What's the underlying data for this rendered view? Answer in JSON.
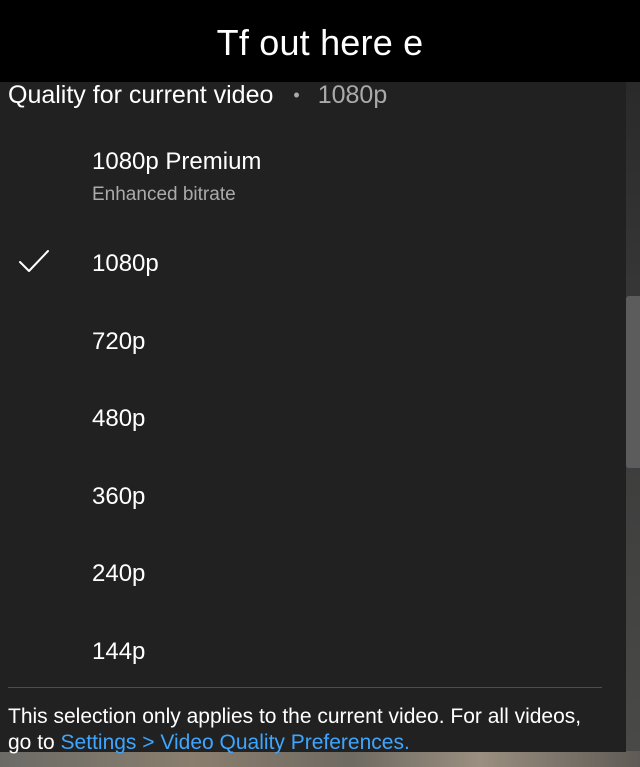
{
  "meme": {
    "title": "Tf out here e"
  },
  "quality_menu": {
    "header_label": "Quality for current video",
    "header_separator": "•",
    "current_quality": "1080p",
    "options": [
      {
        "label": "1080p Premium",
        "sublabel": "Enhanced bitrate",
        "selected": false
      },
      {
        "label": "1080p",
        "selected": true
      },
      {
        "label": "720p",
        "selected": false
      },
      {
        "label": "480p",
        "selected": false
      },
      {
        "label": "360p",
        "selected": false
      },
      {
        "label": "240p",
        "selected": false
      },
      {
        "label": "144p",
        "selected": false
      }
    ],
    "footer_note_text": "This selection only applies to the current video. For all videos, go to ",
    "footer_link_settings": "Settings",
    "footer_link_separator": " > ",
    "footer_link_preferences": "Video Quality Preferences.",
    "icons": {
      "selected": "checkmark-icon"
    },
    "colors": {
      "sheet": "#212121",
      "link": "#3ea6ff",
      "secondary_text": "#aaaaaa"
    }
  }
}
